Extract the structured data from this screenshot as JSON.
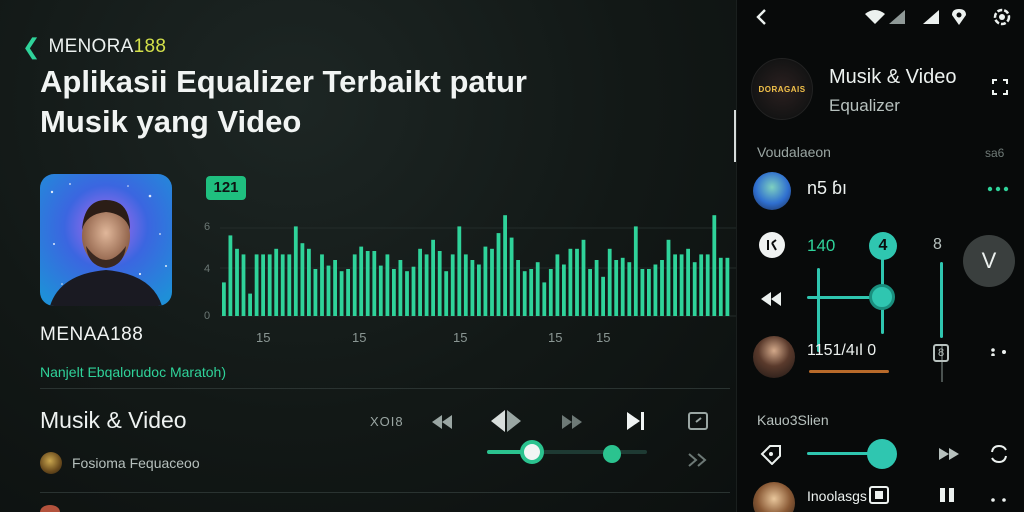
{
  "main": {
    "brand_prefix": "MENORA",
    "brand_suffix": "188",
    "headline_line1": "Aplikasii Equalizer Terbaikt patur",
    "headline_line2": "Musik yang Video",
    "artist_name": "MENAA188",
    "artist_sub": "Nanjelt Ebqalorudoc Maratoh)",
    "eq": {
      "badge": "121",
      "y_ticks": [
        "6",
        "4",
        "0"
      ],
      "x_ticks": [
        "15",
        "15",
        "15",
        "15",
        "15"
      ],
      "bars": [
        0.3,
        0.72,
        0.6,
        0.55,
        0.2,
        0.55,
        0.55,
        0.55,
        0.6,
        0.55,
        0.55,
        0.8,
        0.65,
        0.6,
        0.42,
        0.55,
        0.45,
        0.5,
        0.4,
        0.42,
        0.55,
        0.62,
        0.58,
        0.58,
        0.45,
        0.55,
        0.42,
        0.5,
        0.4,
        0.44,
        0.6,
        0.55,
        0.68,
        0.58,
        0.4,
        0.55,
        0.8,
        0.55,
        0.5,
        0.46,
        0.62,
        0.6,
        0.74,
        0.9,
        0.7,
        0.5,
        0.4,
        0.42,
        0.48,
        0.3,
        0.42,
        0.55,
        0.46,
        0.6,
        0.6,
        0.68,
        0.42,
        0.5,
        0.35,
        0.6,
        0.5,
        0.52,
        0.48,
        0.8,
        0.42,
        0.42,
        0.46,
        0.5,
        0.68,
        0.55,
        0.55,
        0.6,
        0.48,
        0.55,
        0.55,
        0.9,
        0.52,
        0.52
      ],
      "color": "#2fd39a"
    },
    "now_playing": {
      "title": "Musik & Video",
      "subtitle": "Fosioma Fequaceoo",
      "control_label": "XOI8",
      "seek_position": 0.28,
      "volume_position": 0.78
    }
  },
  "side": {
    "title": "Musik & Video",
    "subtitle": "Equalizer",
    "logo_text": "DORAGAIS",
    "section1_label": "Voudalaeon",
    "section1_right": "sa6",
    "item1_value": "n5 ɓı",
    "row_values": {
      "a": "140",
      "b": "4",
      "c": "8"
    },
    "play_label": "V",
    "item2_value": "1151/4ıl 0",
    "item2_badge": "8",
    "section2_label": "Kauo3Slien",
    "item3_label": "Inoolasgs",
    "accent": "#2fc6b0"
  },
  "icons": {
    "back": "chevron-left-icon",
    "wifi": "wifi-icon",
    "signal": "signal-icon",
    "location": "location-icon",
    "settings": "settings-icon"
  }
}
